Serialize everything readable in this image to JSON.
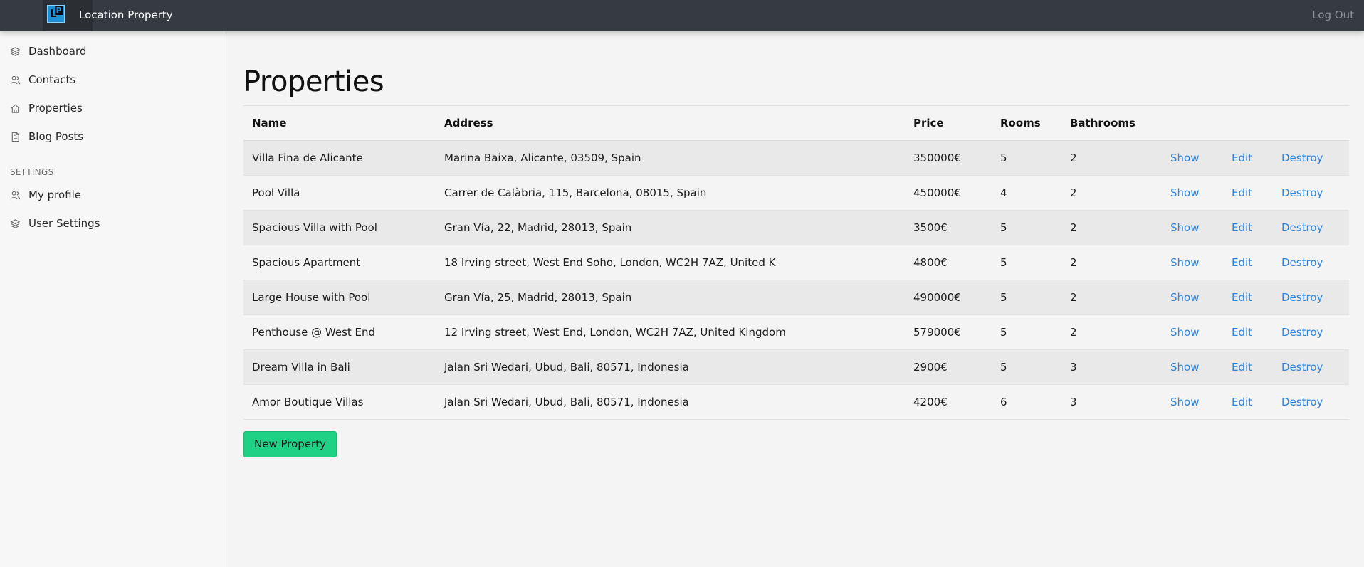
{
  "app": {
    "title": "Location Property",
    "logo_text": "LP",
    "logout_label": "Log Out"
  },
  "sidebar": {
    "items": [
      {
        "label": "Dashboard",
        "icon": "layers-icon"
      },
      {
        "label": "Contacts",
        "icon": "users-icon"
      },
      {
        "label": "Properties",
        "icon": "home-icon"
      },
      {
        "label": "Blog Posts",
        "icon": "document-icon"
      }
    ],
    "settings_label": "SETTINGS",
    "settings_items": [
      {
        "label": "My profile",
        "icon": "users-icon"
      },
      {
        "label": "User Settings",
        "icon": "layers-icon"
      }
    ]
  },
  "main": {
    "title": "Properties",
    "columns": [
      "Name",
      "Address",
      "Price",
      "Rooms",
      "Bathrooms"
    ],
    "actions": {
      "show": "Show",
      "edit": "Edit",
      "destroy": "Destroy"
    },
    "rows": [
      {
        "name": "Villa Fina de Alicante",
        "address": "Marina Baixa, Alicante, 03509, Spain",
        "price": "350000€",
        "rooms": "5",
        "bathrooms": "2"
      },
      {
        "name": "Pool Villa",
        "address": "Carrer de Calàbria, 115, Barcelona, 08015, Spain",
        "price": "450000€",
        "rooms": "4",
        "bathrooms": "2"
      },
      {
        "name": "Spacious Villa with Pool",
        "address": "Gran Vía, 22, Madrid, 28013, Spain",
        "price": "3500€",
        "rooms": "5",
        "bathrooms": "2"
      },
      {
        "name": "Spacious Apartment",
        "address": "18 Irving street, West End Soho, London, WC2H 7AZ, United K",
        "price": "4800€",
        "rooms": "5",
        "bathrooms": "2"
      },
      {
        "name": "Large House with Pool",
        "address": "Gran Vía, 25, Madrid, 28013, Spain",
        "price": "490000€",
        "rooms": "5",
        "bathrooms": "2"
      },
      {
        "name": "Penthouse @ West End",
        "address": "12 Irving street, West End, London, WC2H 7AZ, United Kingdom",
        "price": "579000€",
        "rooms": "5",
        "bathrooms": "2"
      },
      {
        "name": "Dream Villa in Bali",
        "address": "Jalan Sri Wedari, Ubud, Bali, 80571, Indonesia",
        "price": "2900€",
        "rooms": "5",
        "bathrooms": "3"
      },
      {
        "name": "Amor Boutique Villas",
        "address": "Jalan Sri Wedari, Ubud, Bali, 80571, Indonesia",
        "price": "4200€",
        "rooms": "6",
        "bathrooms": "3"
      }
    ],
    "new_button_label": "New Property"
  },
  "colors": {
    "topbar": "#363a41",
    "link": "#2e86de",
    "primary_button": "#1fd184",
    "row_alt": "#e9e9e9"
  }
}
